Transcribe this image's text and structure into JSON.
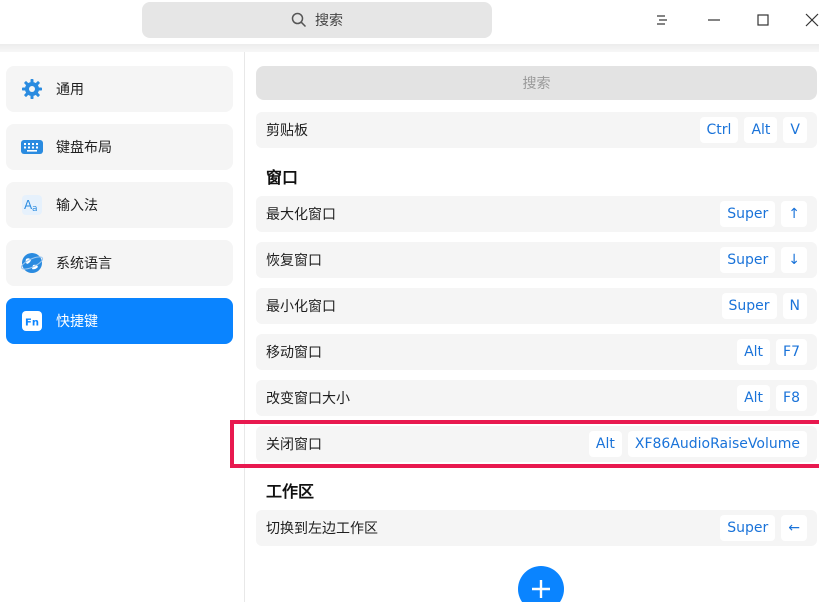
{
  "titlebar": {
    "search_placeholder": "搜索",
    "icons": [
      "search-icon",
      "menu-icon",
      "minimize-icon",
      "maximize-icon",
      "close-icon"
    ]
  },
  "sidebar": {
    "items": [
      {
        "label": "通用",
        "icon": "gear-icon",
        "active": false
      },
      {
        "label": "键盘布局",
        "icon": "keyboard-icon",
        "active": false
      },
      {
        "label": "输入法",
        "icon": "input-method-icon",
        "active": false
      },
      {
        "label": "系统语言",
        "icon": "globe-icon",
        "active": false
      },
      {
        "label": "快捷键",
        "icon": "fn-key-icon",
        "active": true
      }
    ]
  },
  "main": {
    "search_placeholder": "搜索",
    "clipboard": {
      "label": "剪贴板",
      "keys": [
        "Ctrl",
        "Alt",
        "V"
      ]
    },
    "window_section": {
      "title": "窗口",
      "rows": [
        {
          "label": "最大化窗口",
          "keys": [
            "Super",
            "↑"
          ]
        },
        {
          "label": "恢复窗口",
          "keys": [
            "Super",
            "↓"
          ]
        },
        {
          "label": "最小化窗口",
          "keys": [
            "Super",
            "N"
          ]
        },
        {
          "label": "移动窗口",
          "keys": [
            "Alt",
            "F7"
          ]
        },
        {
          "label": "改变窗口大小",
          "keys": [
            "Alt",
            "F8"
          ]
        },
        {
          "label": "关闭窗口",
          "keys": [
            "Alt",
            "XF86AudioRaiseVolume"
          ]
        }
      ]
    },
    "workspace_section": {
      "title": "工作区",
      "rows": [
        {
          "label": "切换到左边工作区",
          "keys": [
            "Super",
            "←"
          ]
        }
      ]
    }
  },
  "colors": {
    "accent": "#0a84ff",
    "key_text": "#1a73d9",
    "highlight": "#e8194f"
  }
}
